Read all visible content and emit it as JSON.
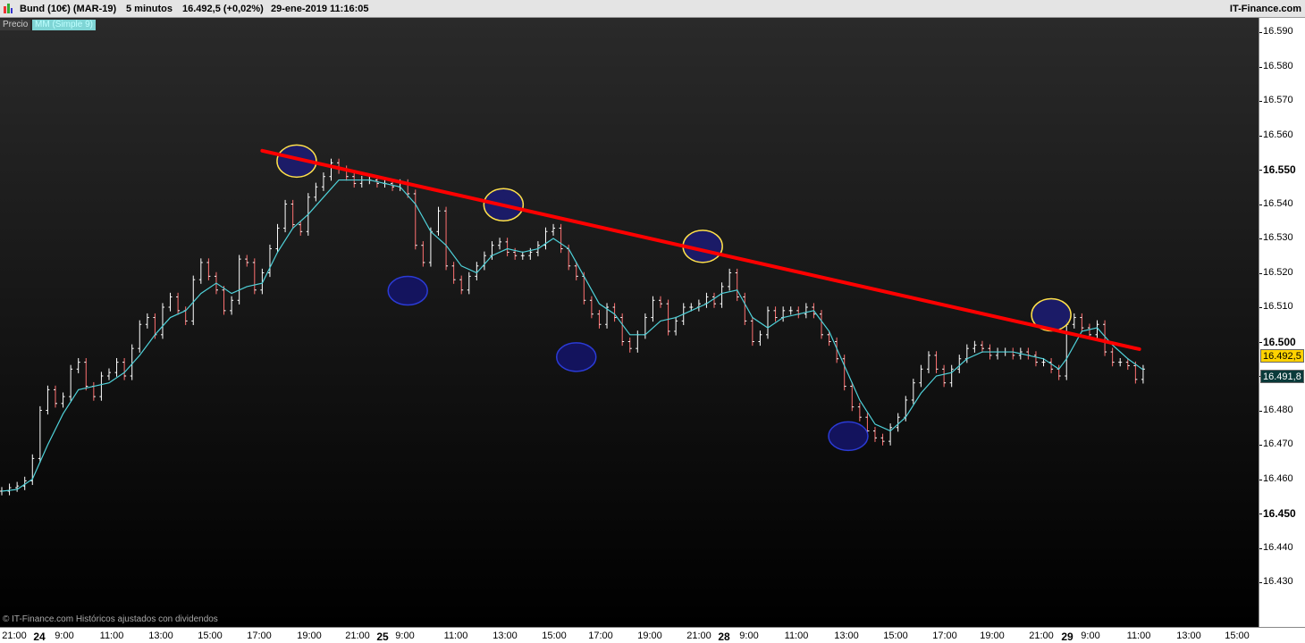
{
  "header": {
    "instrument": "Bund (10€) (MAR-19)",
    "timeframe": "5 minutos",
    "last_quote": "16.492,5 (+0,02%)",
    "datetime": "29-ene-2019 11:16:05",
    "brand": "IT-Finance.com"
  },
  "legend": {
    "price_label": "Precio",
    "ma_label": "MM (Simple 9)"
  },
  "footer": {
    "copyright": "© IT-Finance.com  Históricos ajustados con dividendos"
  },
  "price_axis": {
    "ticks": [
      "16.590",
      "16.580",
      "16.570",
      "16.560",
      "16.550",
      "16.540",
      "16.530",
      "16.520",
      "16.510",
      "16.500",
      "16.490",
      "16.480",
      "16.470",
      "16.460",
      "16.450",
      "16.440",
      "16.430"
    ],
    "bold_ticks": [
      "16.550",
      "16.500",
      "16.450"
    ],
    "last_price_tag": "16.492,5",
    "ma_tag": "16.491,8"
  },
  "time_axis": {
    "labels": [
      {
        "label": "21:00",
        "bold": false
      },
      {
        "label": "24",
        "bold": true
      },
      {
        "label": "9:00",
        "bold": false
      },
      {
        "label": "11:00",
        "bold": false
      },
      {
        "label": "13:00",
        "bold": false
      },
      {
        "label": "15:00",
        "bold": false
      },
      {
        "label": "17:00",
        "bold": false
      },
      {
        "label": "19:00",
        "bold": false
      },
      {
        "label": "21:00",
        "bold": false
      },
      {
        "label": "25",
        "bold": true
      },
      {
        "label": "9:00",
        "bold": false
      },
      {
        "label": "11:00",
        "bold": false
      },
      {
        "label": "13:00",
        "bold": false
      },
      {
        "label": "15:00",
        "bold": false
      },
      {
        "label": "17:00",
        "bold": false
      },
      {
        "label": "19:00",
        "bold": false
      },
      {
        "label": "21:00",
        "bold": false
      },
      {
        "label": "28",
        "bold": true
      },
      {
        "label": "9:00",
        "bold": false
      },
      {
        "label": "11:00",
        "bold": false
      },
      {
        "label": "13:00",
        "bold": false
      },
      {
        "label": "15:00",
        "bold": false
      },
      {
        "label": "17:00",
        "bold": false
      },
      {
        "label": "19:00",
        "bold": false
      },
      {
        "label": "21:00",
        "bold": false
      },
      {
        "label": "29",
        "bold": true
      },
      {
        "label": "9:00",
        "bold": false
      },
      {
        "label": "11:00",
        "bold": false
      },
      {
        "label": "13:00",
        "bold": false
      },
      {
        "label": "15:00",
        "bold": false
      }
    ]
  },
  "chart_data": {
    "type": "line",
    "title": "Bund (10€) (MAR-19)",
    "ylim": [
      16.425,
      16.595
    ],
    "y_ticks": [
      16.59,
      16.58,
      16.57,
      16.56,
      16.55,
      16.54,
      16.53,
      16.52,
      16.51,
      16.5,
      16.49,
      16.48,
      16.47,
      16.46,
      16.45,
      16.44,
      16.43
    ],
    "series": [
      {
        "name": "Precio",
        "color": "#ffffff",
        "points": [
          [
            0,
            16.4565
          ],
          [
            2,
            16.4575
          ],
          [
            4,
            16.458
          ],
          [
            6,
            16.4595
          ],
          [
            8,
            16.466
          ],
          [
            10,
            16.48
          ],
          [
            12,
            16.486
          ],
          [
            14,
            16.482
          ],
          [
            16,
            16.484
          ],
          [
            18,
            16.492
          ],
          [
            20,
            16.494
          ],
          [
            22,
            16.487
          ],
          [
            24,
            16.484
          ],
          [
            26,
            16.49
          ],
          [
            28,
            16.491
          ],
          [
            30,
            16.494
          ],
          [
            32,
            16.49
          ],
          [
            34,
            16.498
          ],
          [
            36,
            16.505
          ],
          [
            38,
            16.507
          ],
          [
            40,
            16.502
          ],
          [
            42,
            16.51
          ],
          [
            44,
            16.513
          ],
          [
            46,
            16.509
          ],
          [
            48,
            16.506
          ],
          [
            50,
            16.518
          ],
          [
            52,
            16.523
          ],
          [
            54,
            16.519
          ],
          [
            56,
            16.515
          ],
          [
            58,
            16.509
          ],
          [
            60,
            16.512
          ],
          [
            62,
            16.524
          ],
          [
            64,
            16.523
          ],
          [
            66,
            16.515
          ],
          [
            68,
            16.52
          ],
          [
            70,
            16.527
          ],
          [
            72,
            16.533
          ],
          [
            74,
            16.54
          ],
          [
            76,
            16.534
          ],
          [
            78,
            16.532
          ],
          [
            80,
            16.542
          ],
          [
            82,
            16.545
          ],
          [
            84,
            16.548
          ],
          [
            86,
            16.552
          ],
          [
            88,
            16.55
          ],
          [
            90,
            16.548
          ],
          [
            92,
            16.546
          ],
          [
            94,
            16.547
          ],
          [
            96,
            16.547
          ],
          [
            98,
            16.546
          ],
          [
            100,
            16.546
          ],
          [
            102,
            16.545
          ],
          [
            104,
            16.546
          ],
          [
            106,
            16.543
          ],
          [
            108,
            16.528
          ],
          [
            110,
            16.523
          ],
          [
            112,
            16.532
          ],
          [
            114,
            16.538
          ],
          [
            116,
            16.522
          ],
          [
            118,
            16.518
          ],
          [
            120,
            16.515
          ],
          [
            122,
            16.519
          ],
          [
            124,
            16.522
          ],
          [
            126,
            16.525
          ],
          [
            128,
            16.528
          ],
          [
            130,
            16.529
          ],
          [
            132,
            16.526
          ],
          [
            134,
            16.525
          ],
          [
            136,
            16.525
          ],
          [
            138,
            16.526
          ],
          [
            140,
            16.528
          ],
          [
            142,
            16.532
          ],
          [
            144,
            16.533
          ],
          [
            146,
            16.527
          ],
          [
            148,
            16.522
          ],
          [
            150,
            16.519
          ],
          [
            152,
            16.512
          ],
          [
            154,
            16.508
          ],
          [
            156,
            16.505
          ],
          [
            158,
            16.51
          ],
          [
            160,
            16.507
          ],
          [
            162,
            16.5
          ],
          [
            164,
            16.498
          ],
          [
            166,
            16.502
          ],
          [
            168,
            16.507
          ],
          [
            170,
            16.512
          ],
          [
            172,
            16.511
          ],
          [
            174,
            16.503
          ],
          [
            176,
            16.506
          ],
          [
            178,
            16.51
          ],
          [
            180,
            16.51
          ],
          [
            182,
            16.511
          ],
          [
            184,
            16.513
          ],
          [
            186,
            16.511
          ],
          [
            188,
            16.516
          ],
          [
            190,
            16.52
          ],
          [
            192,
            16.513
          ],
          [
            194,
            16.506
          ],
          [
            196,
            16.5
          ],
          [
            198,
            16.502
          ],
          [
            200,
            16.509
          ],
          [
            202,
            16.507
          ],
          [
            204,
            16.509
          ],
          [
            206,
            16.509
          ],
          [
            208,
            16.508
          ],
          [
            210,
            16.51
          ],
          [
            212,
            16.508
          ],
          [
            214,
            16.502
          ],
          [
            216,
            16.5
          ],
          [
            218,
            16.495
          ],
          [
            220,
            16.487
          ],
          [
            222,
            16.481
          ],
          [
            224,
            16.478
          ],
          [
            226,
            16.474
          ],
          [
            228,
            16.472
          ],
          [
            230,
            16.471
          ],
          [
            232,
            16.475
          ],
          [
            234,
            16.478
          ],
          [
            236,
            16.483
          ],
          [
            238,
            16.488
          ],
          [
            240,
            16.492
          ],
          [
            242,
            16.496
          ],
          [
            244,
            16.492
          ],
          [
            246,
            16.488
          ],
          [
            248,
            16.492
          ],
          [
            250,
            16.495
          ],
          [
            252,
            16.498
          ],
          [
            254,
            16.499
          ],
          [
            256,
            16.498
          ],
          [
            258,
            16.496
          ],
          [
            260,
            16.497
          ],
          [
            262,
            16.497
          ],
          [
            264,
            16.496
          ],
          [
            266,
            16.497
          ],
          [
            268,
            16.496
          ],
          [
            270,
            16.494
          ],
          [
            272,
            16.494
          ],
          [
            274,
            16.492
          ],
          [
            276,
            16.49
          ],
          [
            278,
            16.505
          ],
          [
            280,
            16.507
          ],
          [
            282,
            16.504
          ],
          [
            284,
            16.502
          ],
          [
            286,
            16.505
          ],
          [
            288,
            16.497
          ],
          [
            290,
            16.494
          ],
          [
            292,
            16.494
          ],
          [
            294,
            16.493
          ],
          [
            296,
            16.489
          ],
          [
            298,
            16.492
          ]
        ]
      },
      {
        "name": "MM (Simple 9)",
        "color": "#4fd1d9",
        "points": [
          [
            0,
            16.4565
          ],
          [
            4,
            16.457
          ],
          [
            8,
            16.46
          ],
          [
            12,
            16.47
          ],
          [
            16,
            16.479
          ],
          [
            20,
            16.486
          ],
          [
            24,
            16.487
          ],
          [
            28,
            16.488
          ],
          [
            32,
            16.491
          ],
          [
            36,
            16.496
          ],
          [
            40,
            16.502
          ],
          [
            44,
            16.507
          ],
          [
            48,
            16.509
          ],
          [
            52,
            16.514
          ],
          [
            56,
            16.517
          ],
          [
            60,
            16.514
          ],
          [
            64,
            16.516
          ],
          [
            68,
            16.517
          ],
          [
            72,
            16.526
          ],
          [
            76,
            16.533
          ],
          [
            80,
            16.537
          ],
          [
            84,
            16.542
          ],
          [
            88,
            16.547
          ],
          [
            92,
            16.547
          ],
          [
            96,
            16.547
          ],
          [
            100,
            16.546
          ],
          [
            104,
            16.545
          ],
          [
            108,
            16.54
          ],
          [
            112,
            16.532
          ],
          [
            116,
            16.528
          ],
          [
            120,
            16.522
          ],
          [
            124,
            16.52
          ],
          [
            128,
            16.525
          ],
          [
            132,
            16.527
          ],
          [
            136,
            16.526
          ],
          [
            140,
            16.527
          ],
          [
            144,
            16.53
          ],
          [
            148,
            16.527
          ],
          [
            152,
            16.519
          ],
          [
            156,
            16.511
          ],
          [
            160,
            16.508
          ],
          [
            164,
            16.502
          ],
          [
            168,
            16.502
          ],
          [
            172,
            16.506
          ],
          [
            176,
            16.507
          ],
          [
            180,
            16.509
          ],
          [
            184,
            16.511
          ],
          [
            188,
            16.514
          ],
          [
            192,
            16.515
          ],
          [
            196,
            16.507
          ],
          [
            200,
            16.504
          ],
          [
            204,
            16.507
          ],
          [
            208,
            16.508
          ],
          [
            212,
            16.509
          ],
          [
            216,
            16.503
          ],
          [
            220,
            16.493
          ],
          [
            224,
            16.483
          ],
          [
            228,
            16.476
          ],
          [
            232,
            16.474
          ],
          [
            236,
            16.478
          ],
          [
            240,
            16.485
          ],
          [
            244,
            16.49
          ],
          [
            248,
            16.491
          ],
          [
            252,
            16.495
          ],
          [
            256,
            16.497
          ],
          [
            260,
            16.497
          ],
          [
            264,
            16.497
          ],
          [
            268,
            16.496
          ],
          [
            272,
            16.495
          ],
          [
            276,
            16.492
          ],
          [
            278,
            16.495
          ],
          [
            282,
            16.503
          ],
          [
            286,
            16.504
          ],
          [
            290,
            16.499
          ],
          [
            294,
            16.495
          ],
          [
            298,
            16.4918
          ]
        ]
      }
    ],
    "trendline": {
      "color": "#ff0000",
      "start": [
        68,
        16.5555
      ],
      "end": [
        297,
        16.4978
      ]
    },
    "highlights": [
      {
        "type": "high",
        "center": [
          77,
          16.5525
        ]
      },
      {
        "type": "high",
        "center": [
          131,
          16.5398
        ]
      },
      {
        "type": "high",
        "center": [
          183,
          16.5277
        ]
      },
      {
        "type": "high",
        "center": [
          274,
          16.5078
        ]
      },
      {
        "type": "low",
        "center": [
          106,
          16.5148
        ]
      },
      {
        "type": "low",
        "center": [
          150,
          16.4955
        ]
      },
      {
        "type": "low",
        "center": [
          221,
          16.4725
        ]
      }
    ],
    "x_axis_labels": [
      "21:00",
      "24",
      "9:00",
      "11:00",
      "13:00",
      "15:00",
      "17:00",
      "19:00",
      "21:00",
      "25",
      "9:00",
      "11:00",
      "13:00",
      "15:00",
      "17:00",
      "19:00",
      "21:00",
      "28",
      "9:00",
      "11:00",
      "13:00",
      "15:00",
      "17:00",
      "19:00",
      "21:00",
      "29",
      "9:00",
      "11:00",
      "13:00",
      "15:00"
    ],
    "grid": false,
    "legend": "top-left"
  }
}
